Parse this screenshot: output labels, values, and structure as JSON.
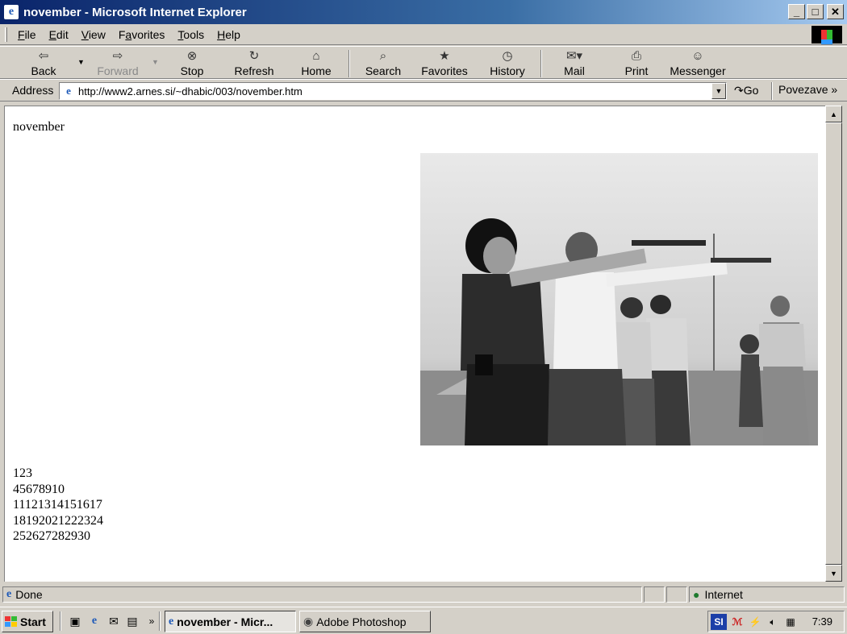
{
  "window": {
    "title": "november - Microsoft Internet Explorer",
    "app_icon": "ie-icon"
  },
  "menu": {
    "items": [
      {
        "label": "File",
        "accel": "F"
      },
      {
        "label": "Edit",
        "accel": "E"
      },
      {
        "label": "View",
        "accel": "V"
      },
      {
        "label": "Favorites",
        "accel": "a"
      },
      {
        "label": "Tools",
        "accel": "T"
      },
      {
        "label": "Help",
        "accel": "H"
      }
    ]
  },
  "toolbar": {
    "back": "Back",
    "forward": "Forward",
    "stop": "Stop",
    "refresh": "Refresh",
    "home": "Home",
    "search": "Search",
    "favorites": "Favorites",
    "history": "History",
    "mail": "Mail",
    "print": "Print",
    "messenger": "Messenger"
  },
  "address": {
    "label": "Address",
    "url": "http://www2.arnes.si/~dhabic/003/november.htm",
    "go": "Go",
    "links": "Povezave"
  },
  "page": {
    "title": "november",
    "lines": [
      "123",
      "45678910",
      "11121314151617",
      "18192021222324",
      "252627282930"
    ]
  },
  "status": {
    "text": "Done",
    "zone": "Internet"
  },
  "taskbar": {
    "start": "Start",
    "tasks": [
      {
        "label": "november - Micr...",
        "active": true
      },
      {
        "label": "Adobe Photoshop",
        "active": false
      }
    ],
    "tray_lang": "SI",
    "clock": "7:39"
  }
}
